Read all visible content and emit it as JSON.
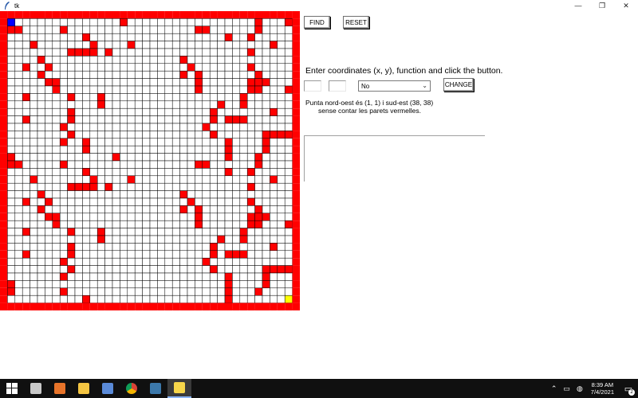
{
  "window": {
    "title": "tk",
    "minimize_glyph": "—",
    "restore_glyph": "❐",
    "close_glyph": "✕"
  },
  "maze": {
    "grid_size": 40,
    "colors": {
      "wall": "#ff0000",
      "open": "#ffffff",
      "grid_line": "#000000",
      "start": "#0000ff",
      "goal": "#ffff00"
    },
    "start_cell": [
      1,
      1
    ],
    "goal_cell": [
      38,
      38
    ],
    "wall_cells": [
      [
        16,
        1
      ],
      [
        34,
        1
      ],
      [
        38,
        1
      ],
      [
        1,
        2
      ],
      [
        2,
        2
      ],
      [
        8,
        2
      ],
      [
        26,
        2
      ],
      [
        27,
        2
      ],
      [
        34,
        2
      ],
      [
        11,
        3
      ],
      [
        30,
        3
      ],
      [
        33,
        3
      ],
      [
        4,
        4
      ],
      [
        12,
        4
      ],
      [
        17,
        4
      ],
      [
        36,
        4
      ],
      [
        9,
        5
      ],
      [
        10,
        5
      ],
      [
        11,
        5
      ],
      [
        12,
        5
      ],
      [
        14,
        5
      ],
      [
        33,
        5
      ],
      [
        5,
        6
      ],
      [
        24,
        6
      ],
      [
        3,
        7
      ],
      [
        6,
        7
      ],
      [
        25,
        7
      ],
      [
        33,
        7
      ],
      [
        5,
        8
      ],
      [
        24,
        8
      ],
      [
        26,
        8
      ],
      [
        34,
        8
      ],
      [
        6,
        9
      ],
      [
        7,
        9
      ],
      [
        26,
        9
      ],
      [
        33,
        9
      ],
      [
        34,
        9
      ],
      [
        35,
        9
      ],
      [
        7,
        10
      ],
      [
        26,
        10
      ],
      [
        33,
        10
      ],
      [
        34,
        10
      ],
      [
        38,
        10
      ],
      [
        3,
        11
      ],
      [
        9,
        11
      ],
      [
        13,
        11
      ],
      [
        32,
        11
      ],
      [
        13,
        12
      ],
      [
        29,
        12
      ],
      [
        32,
        12
      ],
      [
        9,
        13
      ],
      [
        28,
        13
      ],
      [
        36,
        13
      ],
      [
        3,
        14
      ],
      [
        9,
        14
      ],
      [
        28,
        14
      ],
      [
        30,
        14
      ],
      [
        31,
        14
      ],
      [
        32,
        14
      ],
      [
        8,
        15
      ],
      [
        27,
        15
      ],
      [
        9,
        16
      ],
      [
        28,
        16
      ],
      [
        35,
        16
      ],
      [
        36,
        16
      ],
      [
        37,
        16
      ],
      [
        38,
        16
      ],
      [
        8,
        17
      ],
      [
        11,
        17
      ],
      [
        30,
        17
      ],
      [
        35,
        17
      ],
      [
        11,
        18
      ],
      [
        30,
        18
      ],
      [
        35,
        18
      ],
      [
        1,
        19
      ],
      [
        15,
        19
      ],
      [
        30,
        19
      ],
      [
        34,
        19
      ],
      [
        1,
        20
      ],
      [
        2,
        20
      ],
      [
        8,
        20
      ],
      [
        26,
        20
      ],
      [
        27,
        20
      ],
      [
        34,
        20
      ],
      [
        11,
        21
      ],
      [
        30,
        21
      ],
      [
        33,
        21
      ],
      [
        4,
        22
      ],
      [
        12,
        22
      ],
      [
        17,
        22
      ],
      [
        36,
        22
      ],
      [
        9,
        23
      ],
      [
        10,
        23
      ],
      [
        11,
        23
      ],
      [
        12,
        23
      ],
      [
        14,
        23
      ],
      [
        33,
        23
      ],
      [
        5,
        24
      ],
      [
        24,
        24
      ],
      [
        3,
        25
      ],
      [
        6,
        25
      ],
      [
        25,
        25
      ],
      [
        33,
        25
      ],
      [
        5,
        26
      ],
      [
        24,
        26
      ],
      [
        26,
        26
      ],
      [
        34,
        26
      ],
      [
        6,
        27
      ],
      [
        7,
        27
      ],
      [
        26,
        27
      ],
      [
        33,
        27
      ],
      [
        34,
        27
      ],
      [
        35,
        27
      ],
      [
        7,
        28
      ],
      [
        26,
        28
      ],
      [
        33,
        28
      ],
      [
        34,
        28
      ],
      [
        38,
        28
      ],
      [
        3,
        29
      ],
      [
        9,
        29
      ],
      [
        13,
        29
      ],
      [
        32,
        29
      ],
      [
        13,
        30
      ],
      [
        29,
        30
      ],
      [
        32,
        30
      ],
      [
        9,
        31
      ],
      [
        28,
        31
      ],
      [
        36,
        31
      ],
      [
        3,
        32
      ],
      [
        9,
        32
      ],
      [
        28,
        32
      ],
      [
        30,
        32
      ],
      [
        31,
        32
      ],
      [
        32,
        32
      ],
      [
        8,
        33
      ],
      [
        27,
        33
      ],
      [
        9,
        34
      ],
      [
        28,
        34
      ],
      [
        35,
        34
      ],
      [
        36,
        34
      ],
      [
        37,
        34
      ],
      [
        38,
        34
      ],
      [
        8,
        35
      ],
      [
        30,
        35
      ],
      [
        35,
        35
      ],
      [
        1,
        36
      ],
      [
        30,
        36
      ],
      [
        35,
        36
      ],
      [
        1,
        37
      ],
      [
        8,
        37
      ],
      [
        30,
        37
      ],
      [
        34,
        37
      ],
      [
        11,
        38
      ],
      [
        30,
        38
      ]
    ]
  },
  "controls": {
    "find_label": "FIND",
    "reset_label": "RESET",
    "instruction": "Enter coordinates (x, y), function and click the button.",
    "x_value": "",
    "y_value": "",
    "function_value": "No",
    "change_label": "CHANGE",
    "info_line1": "Punta nord-oest és (1, 1) i sud-est (38, 38)",
    "info_line2": "sense contar les parets vermelles.",
    "output_text": ""
  },
  "taskbar": {
    "apps": [
      {
        "name": "start",
        "color": "#ffffff"
      },
      {
        "name": "app-spiral",
        "color": "#c8c8c8"
      },
      {
        "name": "app-s",
        "color": "#e8742a"
      },
      {
        "name": "file-explorer",
        "color": "#f4c542"
      },
      {
        "name": "documents",
        "color": "#5a8ad8"
      },
      {
        "name": "chrome",
        "color": "#db4437"
      },
      {
        "name": "python-idle",
        "color": "#3c78aa"
      },
      {
        "name": "python-tk",
        "color": "#f7d64a"
      }
    ],
    "time": "8:39 AM",
    "date": "7/4/2021",
    "notification_count": "2"
  }
}
